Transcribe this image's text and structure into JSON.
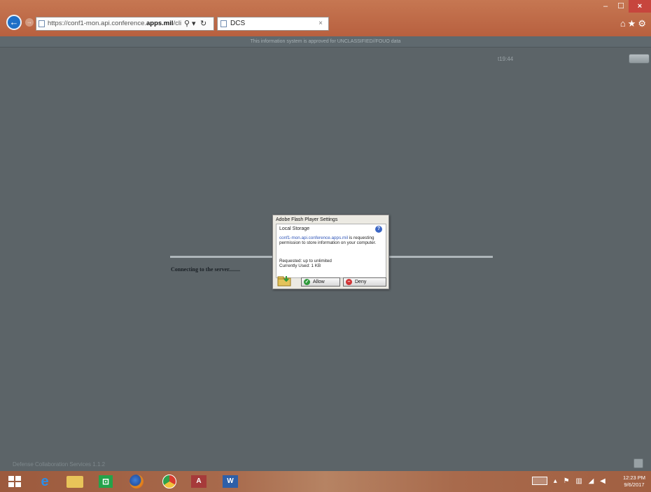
{
  "browser": {
    "address_url": "https://conf1-mon.api.conference.",
    "address_url_bold": "apps.mil",
    "address_url_tail": "/cli",
    "search_glyph": "⚲",
    "dropdown_glyph": "▾",
    "refresh_glyph": "↻",
    "tab_title": "DCS",
    "tab_close": "×",
    "right_tools": "⌂★⚙"
  },
  "banner": {
    "text": "This information system is approved for UNCLASSIFIED//FOUO data"
  },
  "app": {
    "timer": "t19:44",
    "connecting_text": "Connecting to the server........",
    "footer_text": "Defense Collaboration Services 1.1.2"
  },
  "flash_dialog": {
    "title": "Adobe Flash Player Settings",
    "section": "Local Storage",
    "help": "?",
    "domain": "conf1-mon.api.conference.apps.mil",
    "message_suffix": " is requesting permission to store information on your computer.",
    "requested": "Requested: up to unlimited",
    "used": "Currently Used: 1 KB",
    "allow_label": "Allow",
    "deny_label": "Deny"
  },
  "taskbar": {
    "ie_glyph": "e",
    "store_glyph": "⊡",
    "access_label": "A",
    "word_label": "W",
    "clock_time": "12:23 PM",
    "clock_date": "9/6/2017"
  },
  "colors": {
    "chrome": "#b8603f",
    "app_background": "#5c6468",
    "allow_green": "#2f9a3a",
    "deny_red": "#d03434"
  }
}
